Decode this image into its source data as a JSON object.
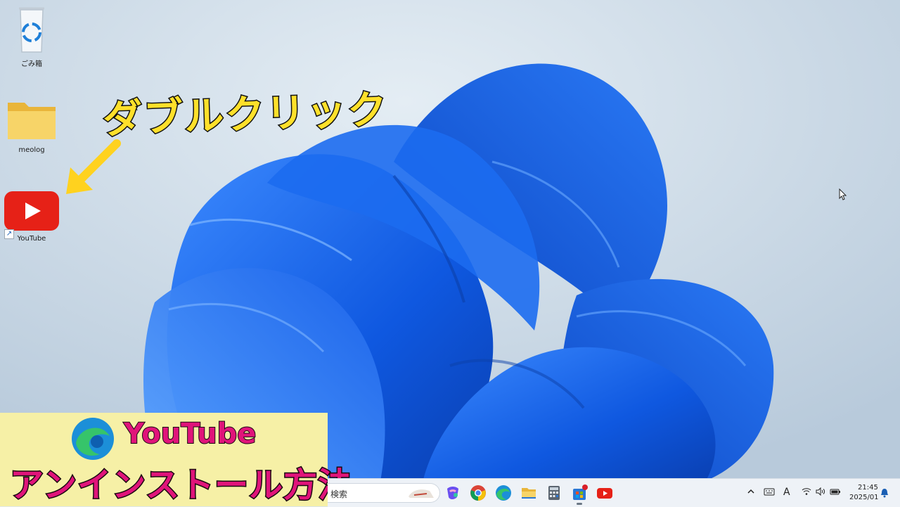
{
  "desktop": {
    "icons": [
      {
        "label": "ごみ箱",
        "icon": "recycle-bin-icon"
      },
      {
        "label": "meolog",
        "icon": "folder-icon"
      },
      {
        "label": "YouTube",
        "icon": "youtube-app-icon"
      }
    ]
  },
  "annotation": {
    "text": "ダブルクリック",
    "color": "#ffe02a"
  },
  "banner": {
    "line1": "YouTube",
    "line2": "アンインストール方法",
    "text_color": "#e0147a",
    "background": "#f6f0a6"
  },
  "taskbar": {
    "search_placeholder": "検索",
    "apps": [
      "copilot-icon",
      "chrome-icon",
      "edge-icon",
      "file-explorer-icon",
      "calculator-icon",
      "store-icon",
      "youtube-icon"
    ],
    "tray": {
      "time": "21:45",
      "date": "2025/01",
      "ime": "A"
    }
  },
  "colors": {
    "accent_blue": "#1a62e8",
    "youtube_red": "#e62117"
  }
}
